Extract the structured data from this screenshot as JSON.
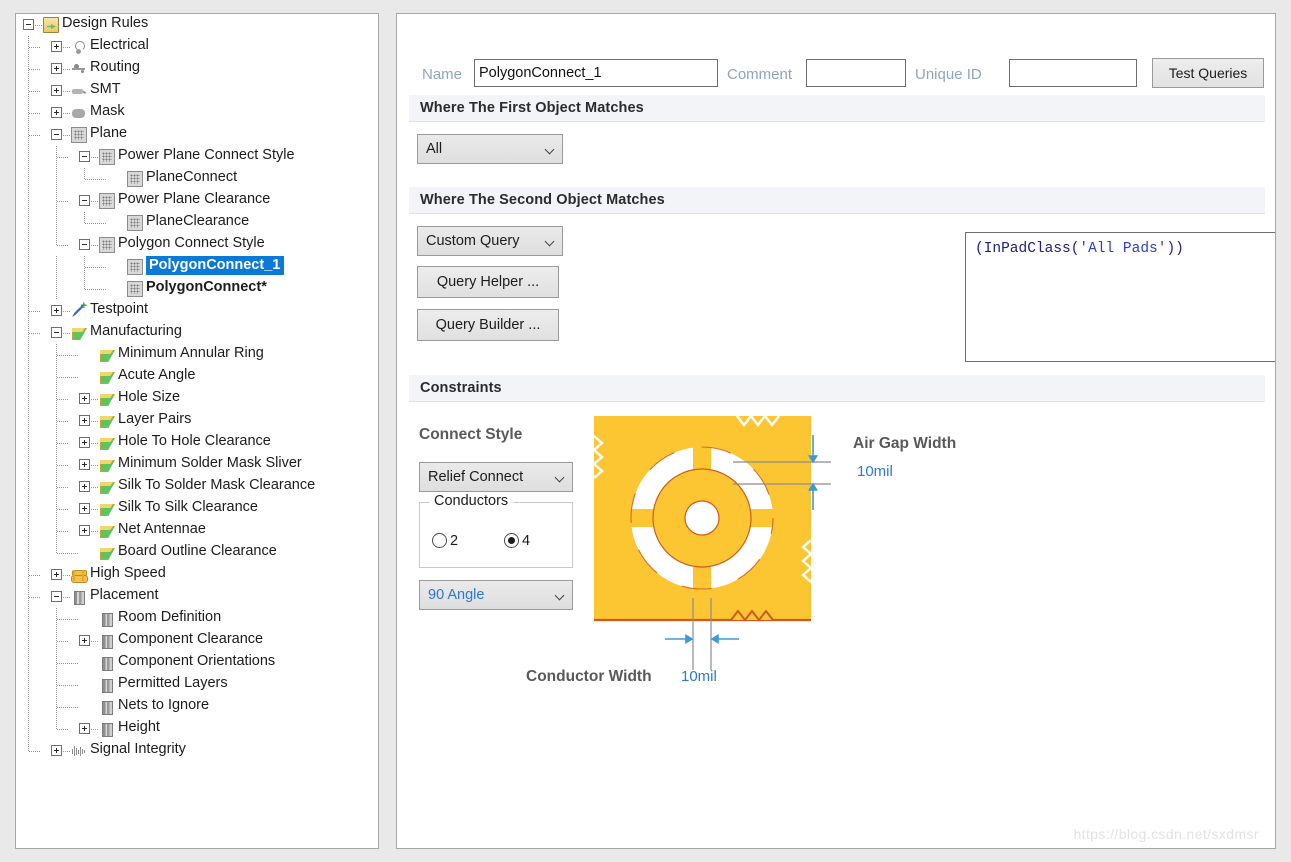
{
  "tree": {
    "items": [
      {
        "label": "Design Rules",
        "depth": 0,
        "expander": "minus",
        "icon": "folder-rules-icon",
        "bold": false,
        "selected": false
      },
      {
        "label": "Electrical",
        "depth": 1,
        "expander": "plus",
        "icon": "electrical-icon",
        "bold": false,
        "selected": false
      },
      {
        "label": "Routing",
        "depth": 1,
        "expander": "plus",
        "icon": "routing-icon",
        "bold": false,
        "selected": false
      },
      {
        "label": "SMT",
        "depth": 1,
        "expander": "plus",
        "icon": "smt-icon",
        "bold": false,
        "selected": false
      },
      {
        "label": "Mask",
        "depth": 1,
        "expander": "plus",
        "icon": "mask-icon",
        "bold": false,
        "selected": false
      },
      {
        "label": "Plane",
        "depth": 1,
        "expander": "minus",
        "icon": "plane-icon",
        "bold": false,
        "selected": false
      },
      {
        "label": "Power Plane Connect Style",
        "depth": 2,
        "expander": "minus",
        "icon": "plane-icon",
        "bold": false,
        "selected": false
      },
      {
        "label": "PlaneConnect",
        "depth": 3,
        "expander": "none",
        "icon": "plane-icon",
        "bold": false,
        "selected": false
      },
      {
        "label": "Power Plane Clearance",
        "depth": 2,
        "expander": "minus",
        "icon": "plane-icon",
        "bold": false,
        "selected": false
      },
      {
        "label": "PlaneClearance",
        "depth": 3,
        "expander": "none",
        "icon": "plane-icon",
        "bold": false,
        "selected": false
      },
      {
        "label": "Polygon Connect Style",
        "depth": 2,
        "expander": "minus",
        "icon": "plane-icon",
        "bold": false,
        "selected": false
      },
      {
        "label": "PolygonConnect_1",
        "depth": 3,
        "expander": "none",
        "icon": "plane-icon",
        "bold": true,
        "selected": true
      },
      {
        "label": "PolygonConnect*",
        "depth": 3,
        "expander": "none",
        "icon": "plane-icon",
        "bold": true,
        "selected": false
      },
      {
        "label": "Testpoint",
        "depth": 1,
        "expander": "plus",
        "icon": "testpoint-icon",
        "bold": false,
        "selected": false
      },
      {
        "label": "Manufacturing",
        "depth": 1,
        "expander": "minus",
        "icon": "manufacturing-icon",
        "bold": false,
        "selected": false
      },
      {
        "label": "Minimum Annular Ring",
        "depth": 2,
        "expander": "none",
        "icon": "manufacturing-icon",
        "bold": false,
        "selected": false
      },
      {
        "label": "Acute Angle",
        "depth": 2,
        "expander": "none",
        "icon": "manufacturing-icon",
        "bold": false,
        "selected": false
      },
      {
        "label": "Hole Size",
        "depth": 2,
        "expander": "plus",
        "icon": "manufacturing-icon",
        "bold": false,
        "selected": false
      },
      {
        "label": "Layer Pairs",
        "depth": 2,
        "expander": "plus",
        "icon": "manufacturing-icon",
        "bold": false,
        "selected": false
      },
      {
        "label": "Hole To Hole Clearance",
        "depth": 2,
        "expander": "plus",
        "icon": "manufacturing-icon",
        "bold": false,
        "selected": false
      },
      {
        "label": "Minimum Solder Mask Sliver",
        "depth": 2,
        "expander": "plus",
        "icon": "manufacturing-icon",
        "bold": false,
        "selected": false
      },
      {
        "label": "Silk To Solder Mask Clearance",
        "depth": 2,
        "expander": "plus",
        "icon": "manufacturing-icon",
        "bold": false,
        "selected": false
      },
      {
        "label": "Silk To Silk Clearance",
        "depth": 2,
        "expander": "plus",
        "icon": "manufacturing-icon",
        "bold": false,
        "selected": false
      },
      {
        "label": "Net Antennae",
        "depth": 2,
        "expander": "plus",
        "icon": "manufacturing-icon",
        "bold": false,
        "selected": false
      },
      {
        "label": "Board Outline Clearance",
        "depth": 2,
        "expander": "none",
        "icon": "manufacturing-icon",
        "bold": false,
        "selected": false
      },
      {
        "label": "High Speed",
        "depth": 1,
        "expander": "plus",
        "icon": "high-speed-icon",
        "bold": false,
        "selected": false
      },
      {
        "label": "Placement",
        "depth": 1,
        "expander": "minus",
        "icon": "placement-icon",
        "bold": false,
        "selected": false
      },
      {
        "label": "Room Definition",
        "depth": 2,
        "expander": "none",
        "icon": "placement-icon",
        "bold": false,
        "selected": false
      },
      {
        "label": "Component Clearance",
        "depth": 2,
        "expander": "plus",
        "icon": "placement-icon",
        "bold": false,
        "selected": false
      },
      {
        "label": "Component Orientations",
        "depth": 2,
        "expander": "none",
        "icon": "placement-icon",
        "bold": false,
        "selected": false
      },
      {
        "label": "Permitted Layers",
        "depth": 2,
        "expander": "none",
        "icon": "placement-icon",
        "bold": false,
        "selected": false
      },
      {
        "label": "Nets to Ignore",
        "depth": 2,
        "expander": "none",
        "icon": "placement-icon",
        "bold": false,
        "selected": false
      },
      {
        "label": "Height",
        "depth": 2,
        "expander": "plus",
        "icon": "placement-icon",
        "bold": false,
        "selected": false
      },
      {
        "label": "Signal Integrity",
        "depth": 1,
        "expander": "plus",
        "icon": "signal-integrity-icon",
        "bold": false,
        "selected": false
      }
    ]
  },
  "header": {
    "name_label": "Name",
    "name_value": "PolygonConnect_1",
    "comment_label": "Comment",
    "comment_value": "",
    "comment_placeholder": "",
    "unique_id_label": "Unique ID",
    "unique_id_value": "",
    "unique_id_placeholder": "",
    "test_queries_label": "Test Queries"
  },
  "first_object": {
    "section_title": "Where The First Object Matches",
    "scope_value": "All"
  },
  "second_object": {
    "section_title": "Where The Second Object Matches",
    "scope_value": "Custom Query",
    "query_helper_label": "Query Helper ...",
    "query_builder_label": "Query Builder ...",
    "query_prefix": "(InPadClass(",
    "query_highlight": "'All Pads'",
    "query_suffix": "))"
  },
  "constraints": {
    "section_title": "Constraints",
    "connect_style_label": "Connect Style",
    "connect_style_value": "Relief Connect",
    "conductors_legend": "Conductors",
    "conductors_option_2": "2",
    "conductors_option_4": "4",
    "conductors_selected": "4",
    "angle_value": "90 Angle",
    "air_gap_label": "Air Gap Width",
    "air_gap_value": "10mil",
    "conductor_width_label": "Conductor Width",
    "conductor_width_value": "10mil"
  },
  "colors": {
    "copper": "#FCC632",
    "copper_edge": "#D2591B",
    "selection_blue": "#0A7AD6",
    "link_blue": "#2D78D0",
    "dim_arrow_blue": "#3C9BD6",
    "dim_line_gray": "#8C8C8C",
    "label_gray": "#595959",
    "section_bg": "#F2F4F7"
  },
  "watermark": {
    "text": "https://blog.csdn.net/sxdmsr"
  }
}
